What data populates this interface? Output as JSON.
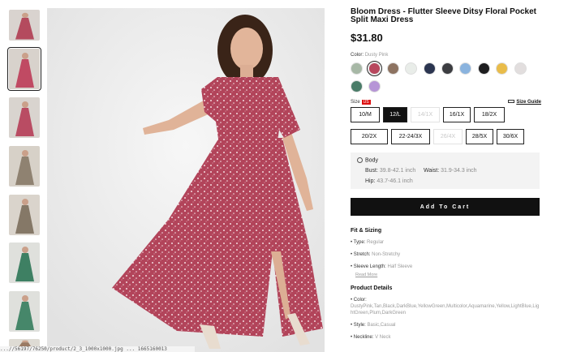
{
  "thumbnails": {
    "scroll_up_icon": "chevron-up",
    "items": [
      {
        "colors": [
          "#d9d3cf",
          "#b44b5e"
        ],
        "active": false
      },
      {
        "colors": [
          "#d8d2cc",
          "#c04a63"
        ],
        "active": true
      },
      {
        "colors": [
          "#d9d4cf",
          "#b94c63"
        ],
        "active": false
      },
      {
        "colors": [
          "#d7d1c8",
          "#8f8271"
        ],
        "active": false
      },
      {
        "colors": [
          "#dad4cc",
          "#857867"
        ],
        "active": false
      },
      {
        "colors": [
          "#dfe0dc",
          "#3e8063"
        ],
        "active": false
      },
      {
        "colors": [
          "#dfe0dc",
          "#46876a"
        ],
        "active": false
      },
      {
        "colors": [
          "#dedbd4",
          "#9a7a64"
        ],
        "active": false
      }
    ]
  },
  "url_text": "...//56197/76250/product/2_3_1000x1000.jpg ... 1665160013",
  "product": {
    "title": "Bloom Dress - Flutter Sleeve Ditsy Floral Pocket Split Maxi Dress",
    "price": "$31.80",
    "color_label": "Color:",
    "color_value": "Dusty Pink",
    "swatches": [
      {
        "color": "#a7b8a6",
        "selected": false
      },
      {
        "color": "#b8475e",
        "selected": true
      },
      {
        "color": "#8d7361",
        "selected": false
      },
      {
        "color": "#e9ede9",
        "selected": false
      },
      {
        "color": "#2b3550",
        "selected": false
      },
      {
        "color": "#3c3d41",
        "selected": false
      },
      {
        "color": "#8ab3de",
        "selected": false
      },
      {
        "color": "#1d1d1f",
        "selected": false
      },
      {
        "color": "#e9bc4a",
        "selected": false
      },
      {
        "color": "#e2dede",
        "selected": false
      },
      {
        "color": "#4a7c68",
        "selected": false
      },
      {
        "color": "#b695d6",
        "selected": false
      }
    ],
    "size_label": "Size",
    "size_region": "US",
    "size_guide_icon": "ruler-icon",
    "size_guide": "Size Guide",
    "sizes": [
      {
        "label": "10/M",
        "state": "available"
      },
      {
        "label": "12/L",
        "state": "selected"
      },
      {
        "label": "14/1X",
        "state": "unavailable"
      },
      {
        "label": "16/1X",
        "state": "available"
      },
      {
        "label": "18/2X",
        "state": "available"
      },
      {
        "label": "20/2X",
        "state": "available"
      },
      {
        "label": "22-24/3X",
        "state": "available"
      },
      {
        "label": "26/4X",
        "state": "unavailable"
      },
      {
        "label": "28/5X",
        "state": "available"
      },
      {
        "label": "30/6X",
        "state": "available"
      }
    ],
    "body": {
      "title": "Body",
      "bust_label": "Bust:",
      "bust_value": "39.8-42.1 inch",
      "waist_label": "Waist:",
      "waist_value": "31.9-34.3 inch",
      "hip_label": "Hip:",
      "hip_value": "43.7-46.1 inch"
    },
    "add_to_cart": "Add To Cart",
    "fit": {
      "title": "Fit & Sizing",
      "type_label": "Type:",
      "type_value": "Regular",
      "stretch_label": "Stretch:",
      "stretch_value": "Non-Stretchy",
      "sleeve_label": "Sleeve Length:",
      "sleeve_value": "Half Sleeve",
      "read_more": "Read More"
    },
    "details": {
      "title": "Product Details",
      "color_label": "Color:",
      "color_value": "DustyPink,Tan,Black,DarkBlue,YellowGreen,Multicolor,Aquamarine,Yellow,LightBlue,LightGreen,Plum,DarkGreen",
      "style_label": "Style:",
      "style_value": "Basic,Casual",
      "neckline_label": "Neckline:",
      "neckline_value": "V Neck"
    }
  }
}
